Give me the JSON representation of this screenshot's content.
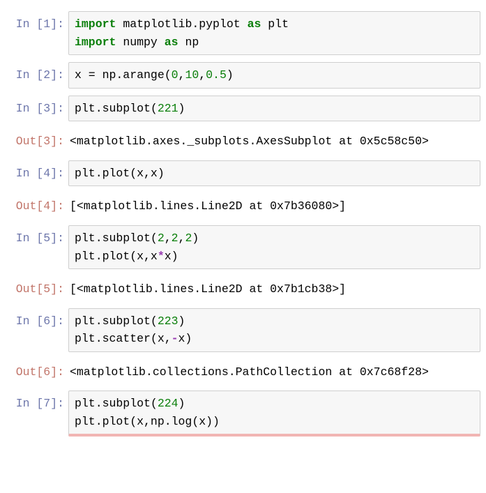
{
  "prompts": {
    "in1": "In  [1]:",
    "in2": "In  [2]:",
    "in3": "In  [3]:",
    "in4": "In  [4]:",
    "in5": "In  [5]:",
    "in6": "In  [6]:",
    "in7": "In  [7]:",
    "out3": "Out[3]:",
    "out4": "Out[4]:",
    "out5": "Out[5]:",
    "out6": "Out[6]:"
  },
  "out3": "<matplotlib.axes._subplots.AxesSubplot at 0x5c58c50>",
  "out4": "[<matplotlib.lines.Line2D at 0x7b36080>]",
  "out5": "[<matplotlib.lines.Line2D at 0x7b1cb38>]",
  "out6": "<matplotlib.collections.PathCollection at 0x7c68f28>",
  "c1": {
    "kw_import1": "import",
    "mod1": " matplotlib.pyplot ",
    "kw_as1": "as",
    "alias1": " plt",
    "kw_import2": "import",
    "mod2": " numpy ",
    "kw_as2": "as",
    "alias2": " np"
  },
  "c2": {
    "p1": "x = np.arange(",
    "n1": "0",
    "c1": ",",
    "n2": "10",
    "c2": ",",
    "n3": "0.5",
    "p2": ")"
  },
  "c3": {
    "p1": "plt.subplot(",
    "n1": "221",
    "p2": ")"
  },
  "c4": {
    "p1": "plt.plot(x,x)"
  },
  "c5": {
    "p1": "plt.subplot(",
    "n1": "2",
    "c1": ",",
    "n2": "2",
    "c2": ",",
    "n3": "2",
    "p2": ")",
    "l2a": "plt.plot(x,x",
    "op": "*",
    "l2b": "x)"
  },
  "c6": {
    "p1": "plt.subplot(",
    "n1": "223",
    "p2": ")",
    "l2a": "plt.scatter(x,",
    "op": "-",
    "l2b": "x)"
  },
  "c7": {
    "p1": "plt.subplot(",
    "n1": "224",
    "p2": ")",
    "l2": "plt.plot(x,np.log(x))"
  }
}
